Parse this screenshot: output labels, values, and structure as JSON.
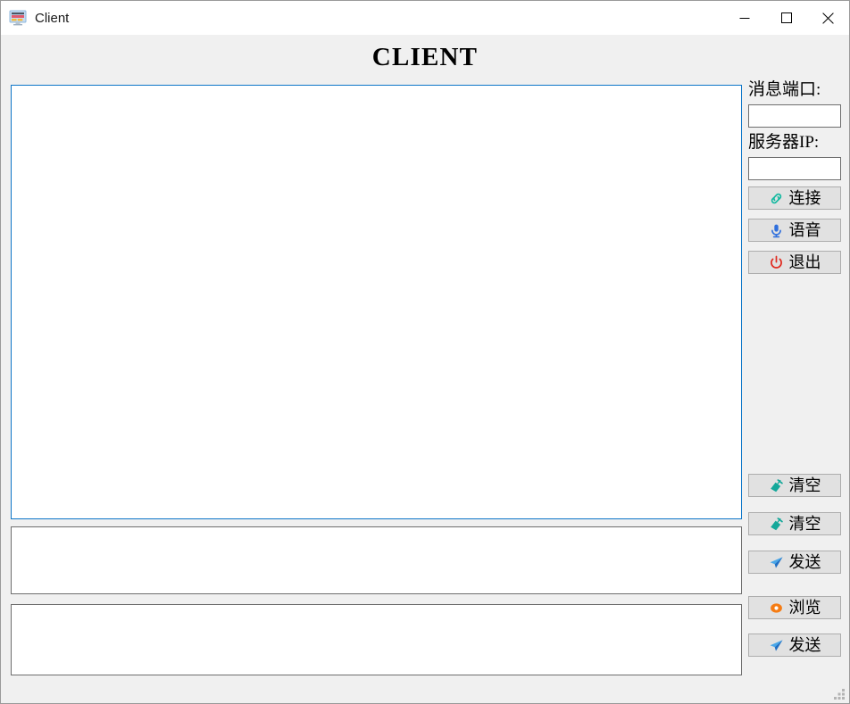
{
  "window": {
    "title": "Client",
    "icon": "monitor-icon",
    "controls": {
      "minimize": "minimize-icon",
      "maximize": "maximize-icon",
      "close": "close-icon"
    }
  },
  "header": {
    "title": "CLIENT"
  },
  "text_areas": {
    "log": {
      "value": "",
      "placeholder": ""
    },
    "message": {
      "value": "",
      "placeholder": ""
    },
    "file": {
      "value": "",
      "placeholder": ""
    }
  },
  "side_panel": {
    "port_label": "消息端口:",
    "port_value": "",
    "ip_label": "服务器IP:",
    "ip_value": "",
    "buttons": [
      {
        "label": "连接",
        "icon": "link-icon",
        "color": "#13b9a0"
      },
      {
        "label": "语音",
        "icon": "microphone-icon",
        "color": "#2f6fdd"
      },
      {
        "label": "退出",
        "icon": "power-icon",
        "color": "#e02b20"
      },
      {
        "label": "清空",
        "icon": "broom-icon",
        "color": "#14a89a"
      },
      {
        "label": "清空",
        "icon": "broom-icon",
        "color": "#14a89a"
      },
      {
        "label": "发送",
        "icon": "send-icon",
        "color": "#2e8fe0"
      },
      {
        "label": "浏览",
        "icon": "browse-icon",
        "color": "#f57c14"
      },
      {
        "label": "发送",
        "icon": "send-icon",
        "color": "#2e8fe0"
      }
    ]
  },
  "colors": {
    "background": "#f0f0f0",
    "focus_border": "#0d76c8",
    "border": "#6e6e6e",
    "button_face": "#e1e1e1"
  }
}
